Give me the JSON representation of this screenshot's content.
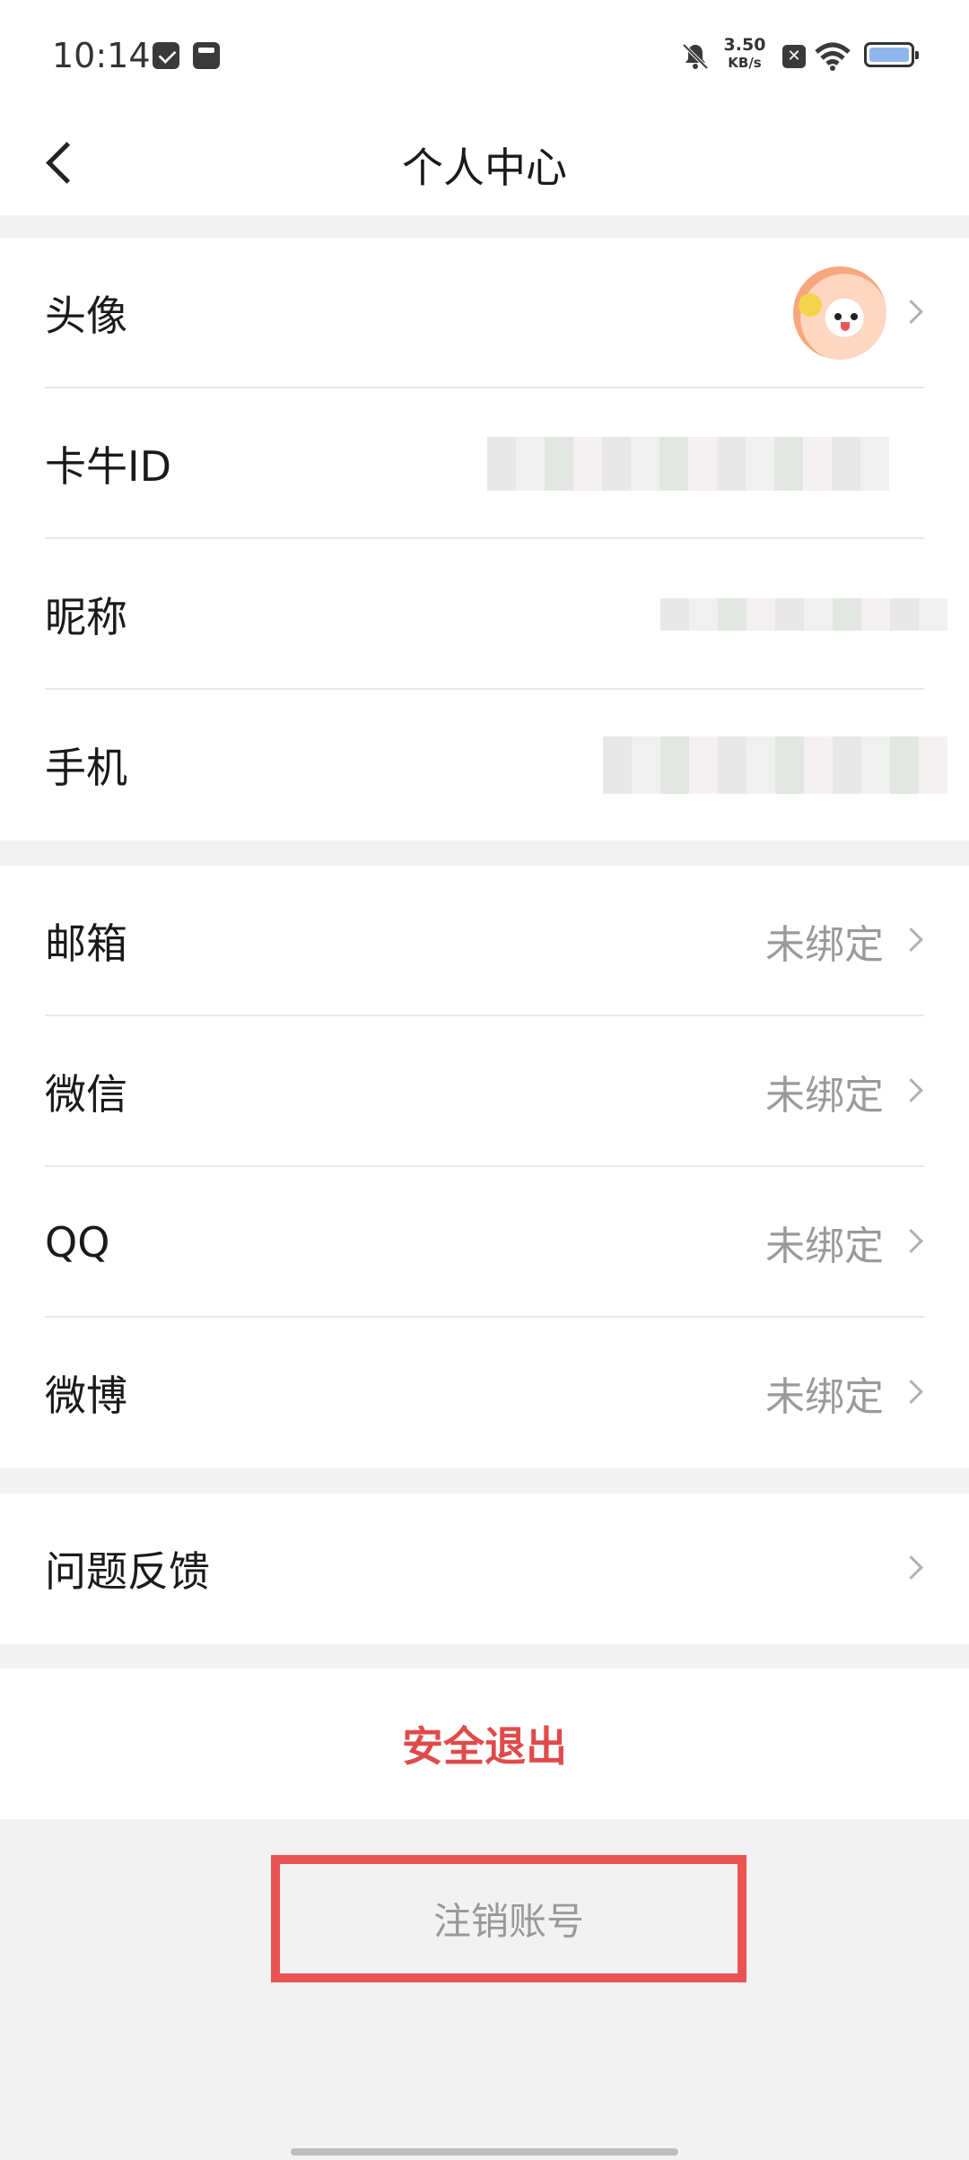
{
  "status_bar": {
    "time": "10:14",
    "net_speed_value": "3.50",
    "net_speed_unit": "KB/s",
    "x_badge": "✕",
    "icons": [
      "mail-icon",
      "inbox-icon",
      "bell-off-icon",
      "close-box-icon",
      "wifi-icon",
      "battery-icon"
    ]
  },
  "header": {
    "title": "个人中心",
    "back_icon": "chevron-left-icon"
  },
  "profile_section": {
    "avatar_label": "头像",
    "id_label": "卡牛ID",
    "nickname_label": "昵称",
    "phone_label": "手机"
  },
  "bind_section": {
    "items": [
      {
        "label": "邮箱",
        "value": "未绑定"
      },
      {
        "label": "微信",
        "value": "未绑定"
      },
      {
        "label": "QQ",
        "value": "未绑定"
      },
      {
        "label": "微博",
        "value": "未绑定"
      }
    ]
  },
  "feedback": {
    "label": "问题反馈"
  },
  "logout": {
    "label": "安全退出",
    "color": "#e04a4a"
  },
  "cancel_account": {
    "label": "注销账号",
    "highlight_color": "#eb5252"
  }
}
